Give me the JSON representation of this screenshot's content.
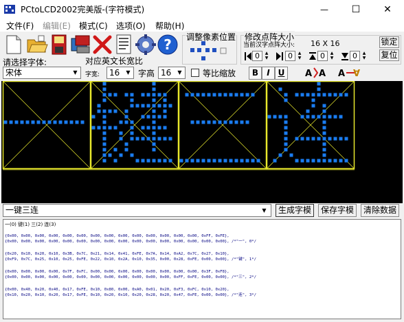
{
  "window": {
    "title": "PCtoLCD2002完美版-(字符模式)",
    "buttons": [
      "—",
      "☐",
      "✕"
    ]
  },
  "menu": [
    {
      "label": "文件(F)",
      "disabled": false
    },
    {
      "label": "编辑(E)",
      "disabled": true
    },
    {
      "label": "模式(C)",
      "disabled": false
    },
    {
      "label": "选项(O)",
      "disabled": false
    },
    {
      "label": "帮助(H)",
      "disabled": false
    }
  ],
  "toolbar": {
    "icons": [
      "new-file-icon",
      "open-folder-icon",
      "save-disk-icon",
      "save-as-icon",
      "delete-icon",
      "properties-icon",
      "settings-gear-icon",
      "help-icon"
    ],
    "adjust_pixel_label": "调整像素位置",
    "resize_dot_label": "修改点阵大小",
    "current_size_label": "当前汉字点阵大小:",
    "current_size_value": "16 X 16",
    "lock_button": "锁定",
    "restore_button": "复位",
    "spin_values": [
      "0",
      "0",
      "0",
      "0"
    ]
  },
  "font_settings": {
    "select_font_label": "请选择字体:",
    "font_name": "宋体",
    "english_ratio_label": "对应英文长宽比",
    "width_label": "字宽:",
    "width_value": "16",
    "height_label": "字高",
    "height_value": "16",
    "scale_checkbox_label": "等比缩放",
    "scale_checked": false,
    "format_buttons": [
      "B",
      "I",
      "U"
    ]
  },
  "canvas": {
    "characters": [
      "一",
      "键",
      "三",
      "连"
    ],
    "grid_color": "#e8e82c",
    "pixel_color": "#1a7cf0",
    "background": "#000000"
  },
  "bottom": {
    "input_text": "一键三连",
    "generate_button": "生成字模",
    "save_button": "保存字模",
    "clear_button": "清除数据",
    "output_header": "一(0) 键(1) 三(2) 连(3)",
    "output_lines": [
      "{0x00, 0x00, 0x00, 0x00, 0x00, 0x00, 0x00, 0x00, 0x00, 0x00, 0x00, 0x00, 0x00, 0x00, 0xFF, 0xFE},",
      "{0x00, 0x00, 0x00, 0x00, 0x00, 0x00, 0x00, 0x00, 0x00, 0x00, 0x00, 0x00, 0x00, 0x00, 0x00, 0x00}, /*\"一\", 0*/",
      "",
      "{0x20, 0x10, 0x20, 0x10, 0x3B, 0x7C, 0x21, 0x14, 0x41, 0xFE, 0x7A, 0x14, 0xA2, 0x7C, 0x27, 0x10},",
      "{0xF9, 0x7C, 0x25, 0x10, 0x25, 0xFE, 0x22, 0x10, 0x2A, 0x10, 0x35, 0x00, 0x28, 0xFE, 0x00, 0x00}, /*\"键\", 1*/",
      "",
      "{0x00, 0x00, 0x00, 0x00, 0x7F, 0xFC, 0x00, 0x00, 0x00, 0x00, 0x00, 0x00, 0x00, 0x00, 0x3F, 0xF8},",
      "{0x00, 0x00, 0x00, 0x00, 0x00, 0x00, 0x00, 0x00, 0x00, 0x00, 0x00, 0x00, 0xFF, 0xFE, 0x00, 0x00}, /*\"三\", 2*/",
      "",
      "{0x00, 0x40, 0x20, 0x40, 0x17, 0xFE, 0x10, 0x80, 0x00, 0xA0, 0x01, 0x20, 0xF3, 0xFC, 0x10, 0x20},",
      "{0x10, 0x20, 0x10, 0x20, 0x17, 0xFE, 0x10, 0x20, 0x10, 0x20, 0x28, 0x20, 0x47, 0xFE, 0x00, 0x00}, /*\"连\", 3*/"
    ]
  }
}
